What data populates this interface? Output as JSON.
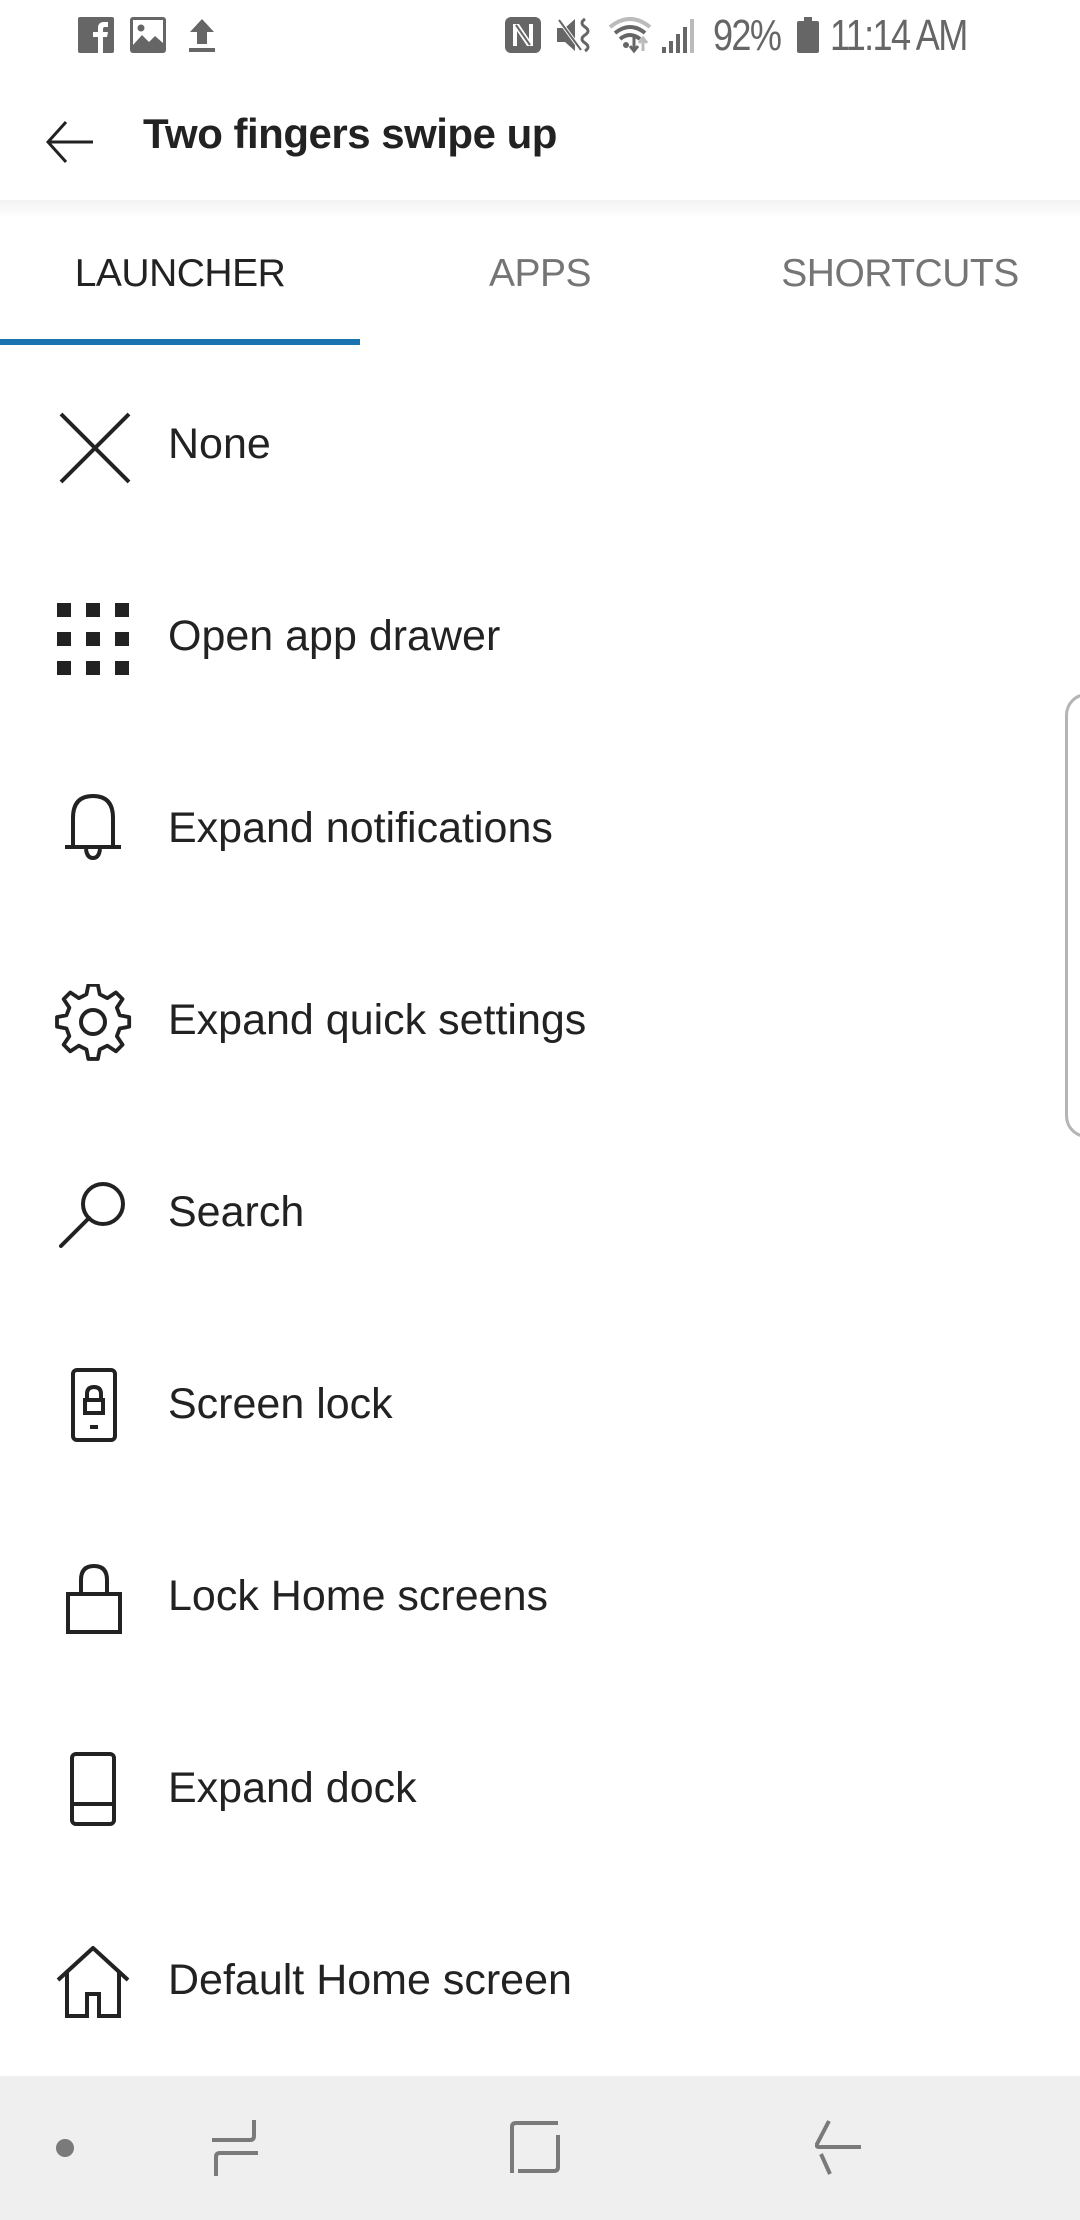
{
  "status_bar": {
    "notification_icons": [
      "facebook-icon",
      "gallery-icon",
      "upload-icon"
    ],
    "system_icons": [
      "nfc-icon",
      "mute-icon",
      "wifi-icon",
      "signal-icon",
      "battery-icon"
    ],
    "battery": "92%",
    "time": "11:14 AM"
  },
  "header": {
    "back_icon": "arrow-left-icon",
    "title": "Two fingers swipe up"
  },
  "tabs": [
    {
      "label": "LAUNCHER",
      "active": true
    },
    {
      "label": "APPS",
      "active": false
    },
    {
      "label": "SHORTCUTS",
      "active": false
    }
  ],
  "accent_color": "#1a73b0",
  "actions": [
    {
      "icon": "close-icon",
      "label": "None"
    },
    {
      "icon": "app-drawer-grid-icon",
      "label": "Open app drawer"
    },
    {
      "icon": "bell-icon",
      "label": "Expand notifications"
    },
    {
      "icon": "gear-icon",
      "label": "Expand quick settings"
    },
    {
      "icon": "search-icon",
      "label": "Search"
    },
    {
      "icon": "phone-lock-icon",
      "label": "Screen lock"
    },
    {
      "icon": "padlock-icon",
      "label": "Lock Home screens"
    },
    {
      "icon": "dock-icon",
      "label": "Expand dock"
    },
    {
      "icon": "home-icon",
      "label": "Default Home screen"
    }
  ],
  "nav_bar": {
    "buttons": [
      "hide-keyboard-dot",
      "recent-apps",
      "home",
      "back"
    ]
  }
}
